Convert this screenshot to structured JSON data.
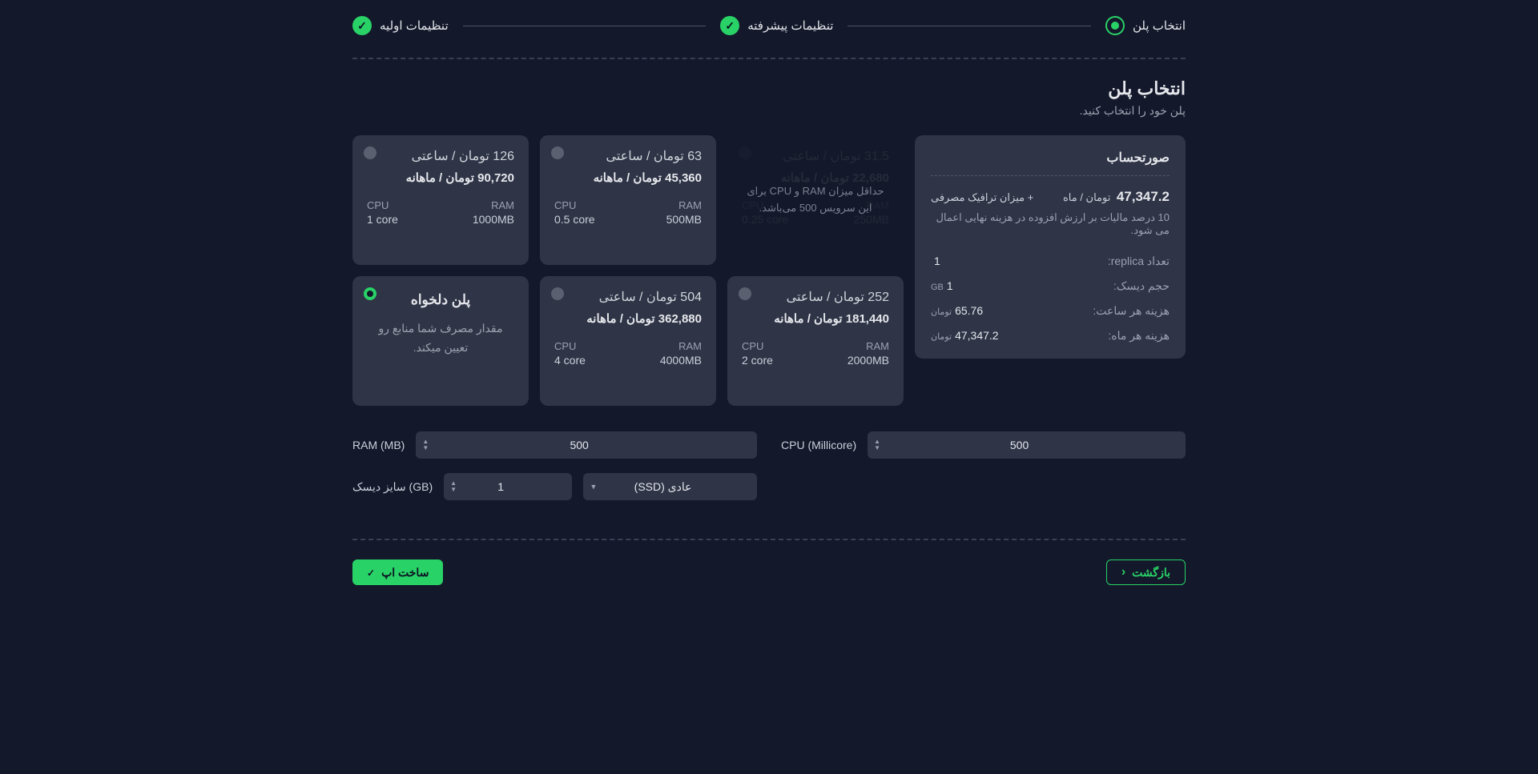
{
  "stepper": {
    "steps": [
      {
        "label": "تنظیمات اولیه",
        "state": "done"
      },
      {
        "label": "تنظیمات پیشرفته",
        "state": "done"
      },
      {
        "label": "انتخاب پلن",
        "state": "current"
      }
    ]
  },
  "section": {
    "title": "انتخاب پلن",
    "subtitle": "پلن خود را انتخاب کنید."
  },
  "plans": [
    {
      "hourly": "31.5 تومان / ساعتی",
      "monthly": "22,680 تومان / ماهانه",
      "cpu": "0.25 core",
      "ram": "250MB",
      "disabled": true,
      "overlay": "حداقل میزان RAM و CPU برای این سرویس 500 می‌باشد."
    },
    {
      "hourly": "63 تومان / ساعتی",
      "monthly": "45,360 تومان / ماهانه",
      "cpu": "0.5 core",
      "ram": "500MB"
    },
    {
      "hourly": "126 تومان / ساعتی",
      "monthly": "90,720 تومان / ماهانه",
      "cpu": "1 core",
      "ram": "1000MB"
    },
    {
      "hourly": "252 تومان / ساعتی",
      "monthly": "181,440 تومان / ماهانه",
      "cpu": "2 core",
      "ram": "2000MB"
    },
    {
      "hourly": "504 تومان / ساعتی",
      "monthly": "362,880 تومان / ماهانه",
      "cpu": "4 core",
      "ram": "4000MB"
    },
    {
      "custom": true,
      "title": "پلن دلخواه",
      "note": "مقدار مصرف شما منابع رو تعیین میکند.",
      "selected": true
    }
  ],
  "invoice": {
    "heading": "صورتحساب",
    "mainValue": "47,347.2",
    "mainUnit": "تومان / ماه",
    "plus": "+ میزان ترافیک مصرفی",
    "taxNote": "10 درصد مالیات بر ارزش افزوده در هزینه نهایی اعمال می شود.",
    "rows": [
      {
        "k": "تعداد replica:",
        "v": "1",
        "u": ""
      },
      {
        "k": "حجم دیسک:",
        "v": "1",
        "u": "GB"
      },
      {
        "k": "هزینه هر ساعت:",
        "v": "65.76",
        "u": "تومان"
      },
      {
        "k": "هزینه هر ماه:",
        "v": "47,347.2",
        "u": "تومان"
      }
    ]
  },
  "inputs": {
    "ramLabel": "RAM (MB)",
    "ramValue": "500",
    "cpuLabel": "CPU (Millicore)",
    "cpuValue": "500",
    "diskLabel": "سایز دیسک (GB)",
    "diskValue": "1",
    "diskTypeValue": "عادی (SSD)"
  },
  "buttons": {
    "back": "بازگشت",
    "create": "ساخت اپ"
  },
  "labels": {
    "cpu": "CPU",
    "ram": "RAM"
  }
}
